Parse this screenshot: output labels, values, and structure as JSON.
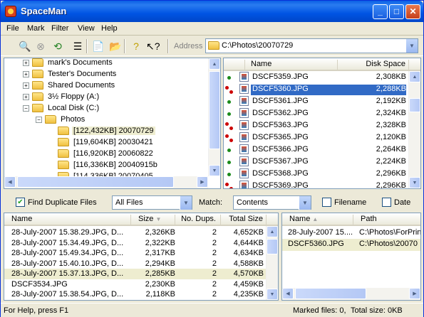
{
  "window": {
    "title": "SpaceMan"
  },
  "menu": [
    "File",
    "Mark",
    "Filter",
    "View",
    "Help"
  ],
  "address": {
    "label": "Address",
    "value": "C:\\Photos\\20070729"
  },
  "tree": [
    {
      "label": "mark's Documents",
      "indent": 0,
      "exp": "+"
    },
    {
      "label": "Tester's Documents",
      "indent": 0,
      "exp": "+"
    },
    {
      "label": "Shared Documents",
      "indent": 0,
      "exp": "+"
    },
    {
      "label": "3½ Floppy (A:)",
      "indent": 0,
      "exp": "+"
    },
    {
      "label": "Local Disk (C:)",
      "indent": 0,
      "exp": "-"
    },
    {
      "label": "Photos",
      "indent": 1,
      "exp": "-"
    },
    {
      "label": "[122,432KB] 20070729",
      "indent": 2,
      "exp": "",
      "selected": true
    },
    {
      "label": "[119,604KB] 20030421",
      "indent": 2,
      "exp": ""
    },
    {
      "label": "[116,920KB] 20060822",
      "indent": 2,
      "exp": ""
    },
    {
      "label": "[116,336KB] 20040915b",
      "indent": 2,
      "exp": ""
    },
    {
      "label": "[114,336KB] 20070405",
      "indent": 2,
      "exp": ""
    }
  ],
  "files": {
    "col_name": "Name",
    "col_size": "Disk Space",
    "rows": [
      {
        "name": "DSCF5359.JPG",
        "size": "2,308KB",
        "dup": false
      },
      {
        "name": "DSCF5360.JPG",
        "size": "2,288KB",
        "dup": true,
        "selected": true
      },
      {
        "name": "DSCF5361.JPG",
        "size": "2,192KB",
        "dup": false
      },
      {
        "name": "DSCF5362.JPG",
        "size": "2,324KB",
        "dup": false
      },
      {
        "name": "DSCF5363.JPG",
        "size": "2,328KB",
        "dup": true
      },
      {
        "name": "DSCF5365.JPG",
        "size": "2,120KB",
        "dup": true
      },
      {
        "name": "DSCF5366.JPG",
        "size": "2,264KB",
        "dup": false
      },
      {
        "name": "DSCF5367.JPG",
        "size": "2,224KB",
        "dup": false
      },
      {
        "name": "DSCF5368.JPG",
        "size": "2,296KB",
        "dup": false
      },
      {
        "name": "DSCF5369.JPG",
        "size": "2,296KB",
        "dup": true
      }
    ]
  },
  "filter": {
    "find_dup_label": "Find Duplicate Files",
    "find_dup_checked": true,
    "type_value": "All Files",
    "match_label": "Match:",
    "match_value": "Contents",
    "filename_label": "Filename",
    "date_label": "Date"
  },
  "dups": {
    "cols": [
      "Name",
      "Size",
      "No. Dups.",
      "Total Size"
    ],
    "rows": [
      [
        "28-July-2007 15.38.29.JPG, D...",
        "2,326KB",
        "2",
        "4,652KB"
      ],
      [
        "28-July-2007 15.34.49.JPG, D...",
        "2,322KB",
        "2",
        "4,644KB"
      ],
      [
        "28-July-2007 15.49.34.JPG, D...",
        "2,317KB",
        "2",
        "4,634KB"
      ],
      [
        "28-July-2007 15.40.10.JPG, D...",
        "2,294KB",
        "2",
        "4,588KB"
      ],
      [
        "28-July-2007 15.37.13.JPG, D...",
        "2,285KB",
        "2",
        "4,570KB"
      ],
      [
        "DSCF3534.JPG",
        "2,230KB",
        "2",
        "4,459KB"
      ],
      [
        "28-July-2007 15.38.54.JPG, D...",
        "2,118KB",
        "2",
        "4,235KB"
      ]
    ]
  },
  "dup_detail": {
    "cols": [
      "Name",
      "Path"
    ],
    "rows": [
      [
        "28-July-2007 15....",
        "C:\\Photos\\ForPrin"
      ],
      [
        "DSCF5360.JPG",
        "C:\\Photos\\20070"
      ]
    ]
  },
  "status": {
    "help": "For Help, press F1",
    "marked": "Marked files: 0,",
    "total": "Total size: 0KB"
  }
}
